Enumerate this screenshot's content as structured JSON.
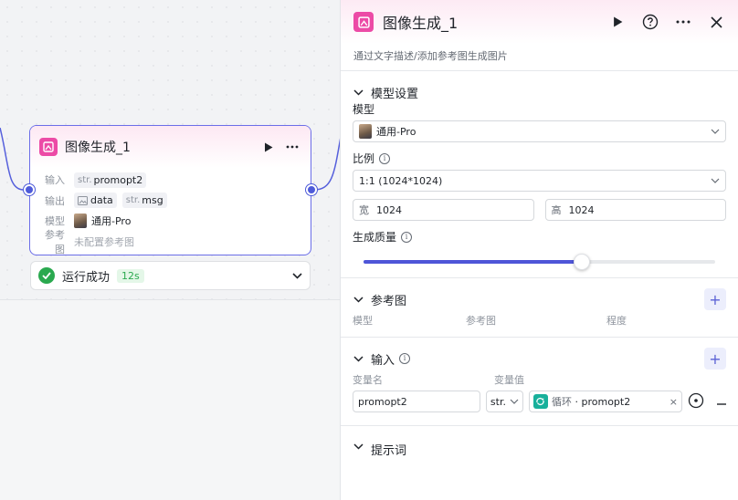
{
  "node": {
    "title": "图像生成_1",
    "rows": {
      "input_label": "输入",
      "input_tag_type": "str.",
      "input_tag_name": "promopt2",
      "output_label": "输出",
      "output_tag1_name": "data",
      "output_tag2_type": "str.",
      "output_tag2_name": "msg",
      "model_label": "模型",
      "model_value": "通用-Pro",
      "ref_label": "参考图",
      "ref_value": "未配置参考图"
    },
    "status_text": "运行成功",
    "status_time": "12s"
  },
  "panel": {
    "title": "图像生成_1",
    "description": "通过文字描述/添加参考图生成图片",
    "model_section": {
      "title": "模型设置",
      "model_label": "模型",
      "model_value": "通用-Pro",
      "ratio_label": "比例",
      "ratio_value": "1:1 (1024*1024)",
      "width_label": "宽",
      "width_value": "1024",
      "height_label": "高",
      "height_value": "1024",
      "quality_label": "生成质量",
      "quality_level": 0.62
    },
    "ref_section": {
      "title": "参考图",
      "col1": "模型",
      "col2": "参考图",
      "col3": "程度"
    },
    "input_section": {
      "title": "输入",
      "col1": "变量名",
      "col2": "变量值",
      "var_name": "promopt2",
      "var_type": "str.",
      "ref_source": "循环",
      "ref_var": "promopt2"
    },
    "next_section_partial": "提示词"
  },
  "colors": {
    "accent": "#4e55d8",
    "app_icon": "#ec4ba6",
    "success": "#2aa94f",
    "loop_icon": "#18b09b"
  }
}
